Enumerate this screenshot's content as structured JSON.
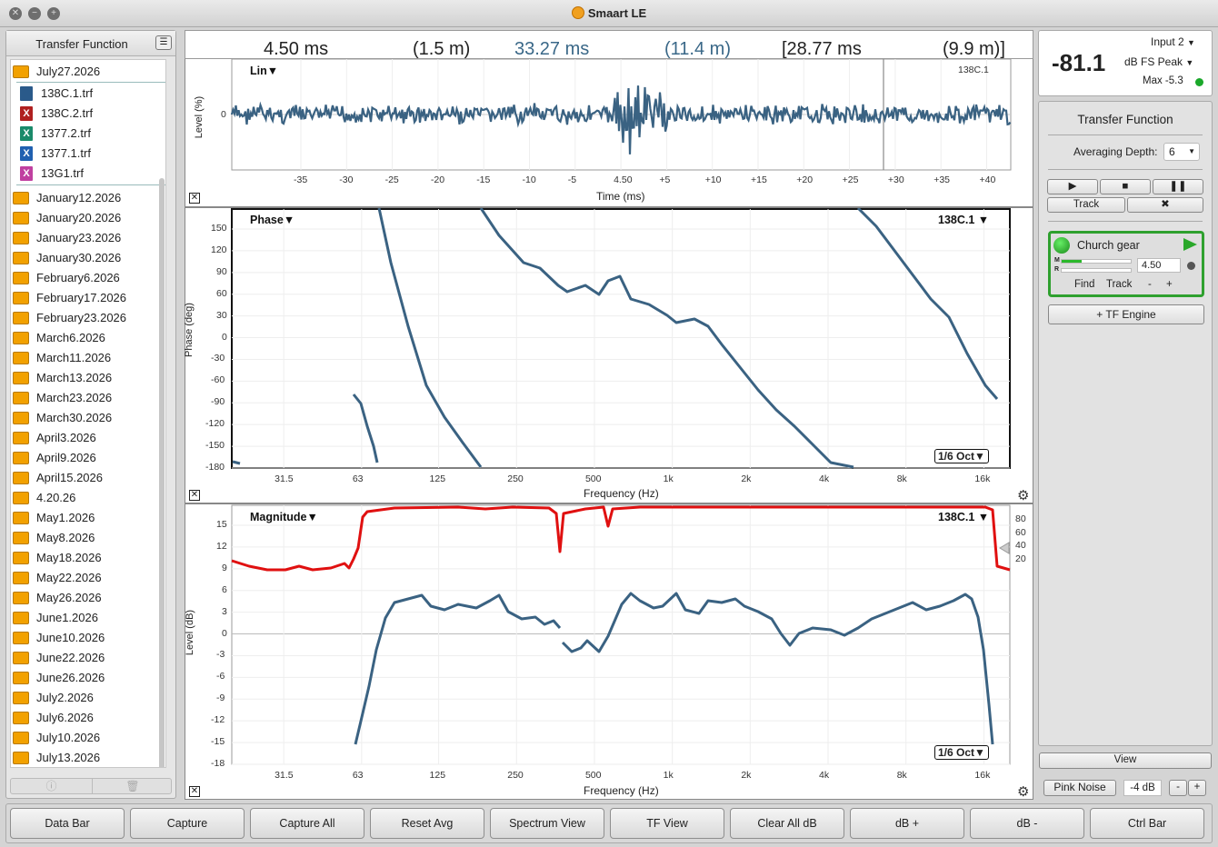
{
  "window": {
    "title": "Smaart LE"
  },
  "sidebar": {
    "title": "Transfer Function",
    "open_folder": "July27.2026",
    "files": [
      {
        "name": "138C.1.trf",
        "icon": "file-icon",
        "color": "#2a5a8a"
      },
      {
        "name": "138C.2.trf",
        "icon": "x-file-icon",
        "color": "#b02020"
      },
      {
        "name": "1377.2.trf",
        "icon": "x-file-icon",
        "color": "#1a8a6a"
      },
      {
        "name": "1377.1.trf",
        "icon": "x-file-icon",
        "color": "#2060b0"
      },
      {
        "name": "13G1.trf",
        "icon": "x-file-icon",
        "color": "#c040a0"
      }
    ],
    "folders": [
      "January12.2026",
      "January20.2026",
      "January23.2026",
      "January30.2026",
      "February6.2026",
      "February17.2026",
      "February23.2026",
      "March6.2026",
      "March11.2026",
      "March13.2026",
      "March23.2026",
      "March30.2026",
      "April3.2026",
      "April9.2026",
      "April15.2026",
      "4.20.26",
      "May1.2026",
      "May8.2026",
      "May18.2026",
      "May22.2026",
      "May26.2026",
      "June1.2026",
      "June10.2026",
      "June22.2026",
      "June26.2026",
      "July2.2026",
      "July6.2026",
      "July10.2026",
      "July13.2026"
    ]
  },
  "delay_bar": {
    "delay1": "4.50 ms",
    "dist1": "(1.5 m)",
    "delay2": "33.27 ms",
    "dist2": "(11.4 m)",
    "delay3": "[28.77 ms",
    "dist3": "(9.9 m)]"
  },
  "impulse": {
    "title": "Lin▼",
    "trace": "138C.1",
    "ylabel": "Level (%)",
    "xlabel": "Time (ms)",
    "y_tick": "0",
    "x_ticks": [
      "-35",
      "-30",
      "-25",
      "-20",
      "-15",
      "-10",
      "-5",
      "4.50",
      "+5",
      "+10",
      "+15",
      "+20",
      "+25",
      "+30",
      "+35",
      "+40"
    ]
  },
  "phase": {
    "title": "Phase▼",
    "trace": "138C.1 ▼",
    "ylabel": "Phase (deg)",
    "xlabel": "Frequency (Hz)",
    "smoothing": "1/6 Oct▼",
    "y_ticks": [
      "150",
      "120",
      "90",
      "60",
      "30",
      "0",
      "-30",
      "-60",
      "-90",
      "-120",
      "-150",
      "-180"
    ],
    "x_ticks": [
      "31.5",
      "63",
      "125",
      "250",
      "500",
      "1k",
      "2k",
      "4k",
      "8k",
      "16k"
    ]
  },
  "magnitude": {
    "title": "Magnitude▼",
    "trace": "138C.1 ▼",
    "ylabel": "Level (dB)",
    "xlabel": "Frequency (Hz)",
    "smoothing": "1/6 Oct▼",
    "y_ticks": [
      "15",
      "12",
      "9",
      "6",
      "3",
      "0",
      "-3",
      "-6",
      "-9",
      "-12",
      "-15",
      "-18"
    ],
    "x_ticks": [
      "31.5",
      "63",
      "125",
      "250",
      "500",
      "1k",
      "2k",
      "4k",
      "8k",
      "16k"
    ],
    "coherence_ticks": [
      "80",
      "60",
      "40",
      "20"
    ]
  },
  "meter": {
    "value": "-81.1",
    "input": "Input 2",
    "mode": "dB FS Peak",
    "max": "Max -5.3"
  },
  "tf_panel": {
    "title": "Transfer Function",
    "averaging_label": "Averaging Depth:",
    "averaging_value": "6",
    "track_label": "Track",
    "measurement_name": "Church gear",
    "delay_value": "4.50",
    "find_label": "Find",
    "track2_label": "Track",
    "minus_label": "-",
    "plus_label": "+",
    "add_engine_label": "+ TF Engine",
    "view_label": "View",
    "pink_noise_label": "Pink Noise",
    "pink_level": "-4 dB",
    "status_color": "#1aa82a"
  },
  "bottom_bar": [
    "Data Bar",
    "Capture",
    "Capture All",
    "Reset Avg",
    "Spectrum View",
    "TF View",
    "Clear All dB",
    "dB +",
    "dB -",
    "Ctrl Bar"
  ]
}
